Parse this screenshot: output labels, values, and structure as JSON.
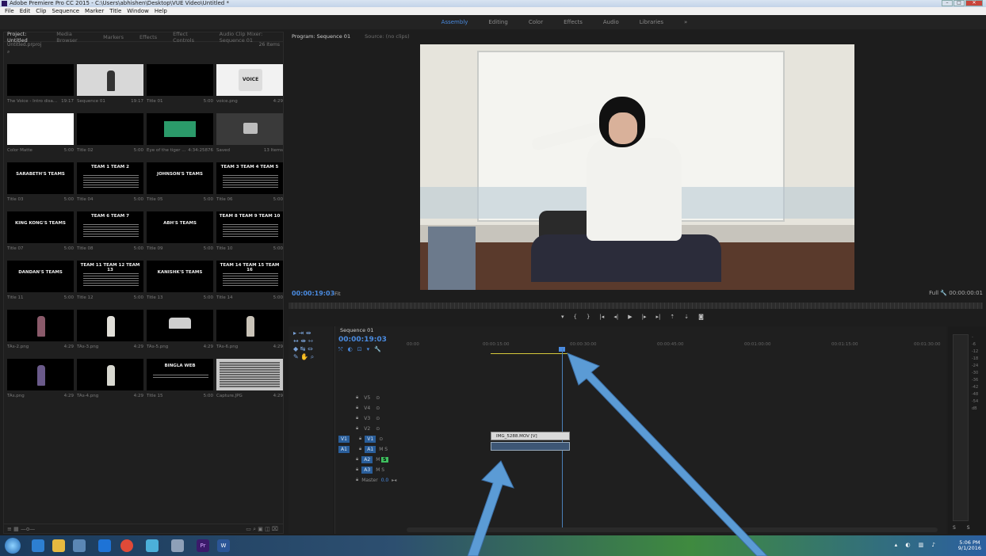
{
  "window": {
    "title": "Adobe Premiere Pro CC 2015 - C:\\Users\\abhishen\\Desktop\\VUE Video\\Untitled *"
  },
  "menu": [
    "File",
    "Edit",
    "Clip",
    "Sequence",
    "Marker",
    "Title",
    "Window",
    "Help"
  ],
  "workspaces": [
    "Assembly",
    "Editing",
    "Color",
    "Effects",
    "Audio",
    "Libraries"
  ],
  "project_panel": {
    "tabs": [
      "Project: Untitled",
      "Media Browser",
      "Markers",
      "Effects",
      "Effect Controls",
      "Audio Clip Mixer: Sequence 01"
    ],
    "file": "Untitled.prproj",
    "item_count": "26 Items",
    "items": [
      {
        "name": "The Voice - Intro disa...",
        "dur": "19:17"
      },
      {
        "name": "Sequence 01",
        "dur": "19:17"
      },
      {
        "name": "Title 01",
        "dur": "5:00"
      },
      {
        "name": "voice.png",
        "dur": "4:29"
      },
      {
        "name": "Color Matte",
        "dur": "5:00"
      },
      {
        "name": "Title 02",
        "dur": "5:00"
      },
      {
        "name": "Eye of the tiger ...",
        "dur": "4:34:25876"
      },
      {
        "name": "Saved",
        "dur": "13 Items"
      },
      {
        "name": "Title 03",
        "dur": "5:00",
        "thumb_text": "SARABETH'S TEAMS"
      },
      {
        "name": "Title 04",
        "dur": "5:00",
        "thumb_text": "TEAM 1   TEAM 2"
      },
      {
        "name": "Title 05",
        "dur": "5:00",
        "thumb_text": "JOHNSON'S TEAMS"
      },
      {
        "name": "Title 06",
        "dur": "5:00",
        "thumb_text": "TEAM 3  TEAM 4  TEAM 5"
      },
      {
        "name": "Title 07",
        "dur": "5:00",
        "thumb_text": "KING KONG'S TEAMS"
      },
      {
        "name": "Title 08",
        "dur": "5:00",
        "thumb_text": "TEAM 6   TEAM 7"
      },
      {
        "name": "Title 09",
        "dur": "5:00",
        "thumb_text": "ABH'S TEAMS"
      },
      {
        "name": "Title 10",
        "dur": "5:00",
        "thumb_text": "TEAM 8  TEAM 9  TEAM 10"
      },
      {
        "name": "Title 11",
        "dur": "5:00",
        "thumb_text": "DANDAN'S TEAMS"
      },
      {
        "name": "Title 12",
        "dur": "5:00",
        "thumb_text": "TEAM 11  TEAM 12  TEAM 13"
      },
      {
        "name": "Title 13",
        "dur": "5:00",
        "thumb_text": "KANISHK'S TEAMS"
      },
      {
        "name": "Title 14",
        "dur": "5:00",
        "thumb_text": "TEAM 14  TEAM 15  TEAM 16"
      },
      {
        "name": "TAs-2.png",
        "dur": "4:29"
      },
      {
        "name": "TAs-3.png",
        "dur": "4:29"
      },
      {
        "name": "TAs-5.png",
        "dur": "4:29"
      },
      {
        "name": "TAs-6.png",
        "dur": "4:29"
      },
      {
        "name": "TAs.png",
        "dur": "4:29"
      },
      {
        "name": "TAs-4.png",
        "dur": "4:29"
      },
      {
        "name": "Title 15",
        "dur": "5:00",
        "thumb_text": "BINGLA WEB"
      },
      {
        "name": "Capture.JPG",
        "dur": "4:29"
      }
    ]
  },
  "program_monitor": {
    "tabs": [
      "Program: Sequence 01",
      "Source: (no clips)"
    ],
    "timecode": "00:00:19:03",
    "fit": "Fit",
    "quality": "Full",
    "duration": "00:00:00:01"
  },
  "timeline": {
    "tab": "Sequence 01",
    "timecode": "00:00:19:03",
    "ruler": [
      "00:00",
      "00:00:15:00",
      "00:00:30:00",
      "00:00:45:00",
      "00:01:00:00",
      "00:01:15:00",
      "00:01:30:00"
    ],
    "tracks": [
      {
        "label": "V5"
      },
      {
        "label": "V4"
      },
      {
        "label": "V3"
      },
      {
        "label": "V2"
      },
      {
        "label": "V1",
        "source": "V1"
      },
      {
        "label": "A1",
        "source": "A1"
      },
      {
        "label": "A2"
      },
      {
        "label": "A3"
      },
      {
        "label": "Master",
        "value": "0.0"
      }
    ],
    "video_clip": "IMG_5288.MOV [V]"
  },
  "taskbar": {
    "time": "5:06 PM",
    "date": "9/1/2016"
  },
  "colors": {
    "accent": "#4a8be0",
    "arrow": "#5b9bd5"
  }
}
